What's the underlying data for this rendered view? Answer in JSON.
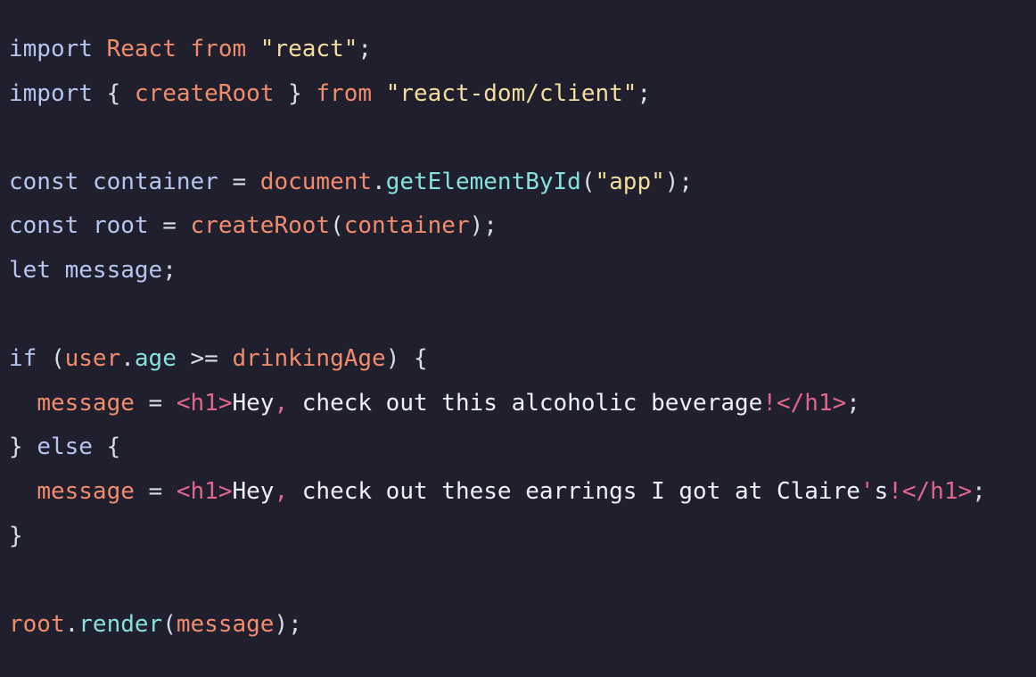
{
  "colors": {
    "background": "#201f2e",
    "keyword": "#b4c6ee",
    "identifier": "#f08c6c",
    "string": "#f3dd9c",
    "method": "#86e1dd",
    "punctuation": "#d9dbe6",
    "jsx_text": "#eef0f6",
    "jsx_tag": "#e2658d"
  },
  "code": {
    "lines": [
      [
        {
          "t": "import",
          "c": "keyword"
        },
        {
          "t": " ",
          "c": "punct"
        },
        {
          "t": "React",
          "c": "ident"
        },
        {
          "t": " ",
          "c": "punct"
        },
        {
          "t": "from",
          "c": "ident"
        },
        {
          "t": " ",
          "c": "punct"
        },
        {
          "t": "\"react\"",
          "c": "string"
        },
        {
          "t": ";",
          "c": "punct"
        }
      ],
      [
        {
          "t": "import",
          "c": "keyword"
        },
        {
          "t": " { ",
          "c": "punct"
        },
        {
          "t": "createRoot",
          "c": "ident"
        },
        {
          "t": " } ",
          "c": "punct"
        },
        {
          "t": "from",
          "c": "ident"
        },
        {
          "t": " ",
          "c": "punct"
        },
        {
          "t": "\"react-dom/client\"",
          "c": "string"
        },
        {
          "t": ";",
          "c": "punct"
        }
      ],
      [],
      [
        {
          "t": "const",
          "c": "keyword"
        },
        {
          "t": " ",
          "c": "punct"
        },
        {
          "t": "container",
          "c": "keyword"
        },
        {
          "t": " = ",
          "c": "punct"
        },
        {
          "t": "document",
          "c": "ident"
        },
        {
          "t": ".",
          "c": "punct"
        },
        {
          "t": "getElementById",
          "c": "method"
        },
        {
          "t": "(",
          "c": "punct"
        },
        {
          "t": "\"app\"",
          "c": "string"
        },
        {
          "t": ");",
          "c": "punct"
        }
      ],
      [
        {
          "t": "const",
          "c": "keyword"
        },
        {
          "t": " ",
          "c": "punct"
        },
        {
          "t": "root",
          "c": "keyword"
        },
        {
          "t": " = ",
          "c": "punct"
        },
        {
          "t": "createRoot",
          "c": "ident"
        },
        {
          "t": "(",
          "c": "punct"
        },
        {
          "t": "container",
          "c": "ident"
        },
        {
          "t": ");",
          "c": "punct"
        }
      ],
      [
        {
          "t": "let",
          "c": "keyword"
        },
        {
          "t": " ",
          "c": "punct"
        },
        {
          "t": "message",
          "c": "keyword"
        },
        {
          "t": ";",
          "c": "punct"
        }
      ],
      [],
      [
        {
          "t": "if",
          "c": "keyword"
        },
        {
          "t": " (",
          "c": "punct"
        },
        {
          "t": "user",
          "c": "ident"
        },
        {
          "t": ".",
          "c": "punct"
        },
        {
          "t": "age",
          "c": "method"
        },
        {
          "t": " >= ",
          "c": "punct"
        },
        {
          "t": "drinkingAge",
          "c": "ident"
        },
        {
          "t": ") {",
          "c": "punct"
        }
      ],
      [
        {
          "t": "  ",
          "c": "punct"
        },
        {
          "t": "message",
          "c": "ident"
        },
        {
          "t": " = ",
          "c": "punct"
        },
        {
          "t": "<h1>",
          "c": "tag"
        },
        {
          "t": "Hey",
          "c": "plain"
        },
        {
          "t": ",",
          "c": "tag"
        },
        {
          "t": " check out this alcoholic beverage",
          "c": "plain"
        },
        {
          "t": "!</h1>",
          "c": "tag"
        },
        {
          "t": ";",
          "c": "punct"
        }
      ],
      [
        {
          "t": "} ",
          "c": "punct"
        },
        {
          "t": "else",
          "c": "keyword"
        },
        {
          "t": " {",
          "c": "punct"
        }
      ],
      [
        {
          "t": "  ",
          "c": "punct"
        },
        {
          "t": "message",
          "c": "ident"
        },
        {
          "t": " = ",
          "c": "punct"
        },
        {
          "t": "<h1>",
          "c": "tag"
        },
        {
          "t": "Hey",
          "c": "plain"
        },
        {
          "t": ",",
          "c": "tag"
        },
        {
          "t": " check out these earrings I got at Claire",
          "c": "plain"
        },
        {
          "t": "'",
          "c": "tag"
        },
        {
          "t": "s",
          "c": "plain"
        },
        {
          "t": "!</h1>",
          "c": "tag"
        },
        {
          "t": ";",
          "c": "punct"
        }
      ],
      [
        {
          "t": "}",
          "c": "punct"
        }
      ],
      [],
      [
        {
          "t": "root",
          "c": "ident"
        },
        {
          "t": ".",
          "c": "punct"
        },
        {
          "t": "render",
          "c": "method"
        },
        {
          "t": "(",
          "c": "punct"
        },
        {
          "t": "message",
          "c": "ident"
        },
        {
          "t": ");",
          "c": "punct"
        }
      ]
    ]
  }
}
